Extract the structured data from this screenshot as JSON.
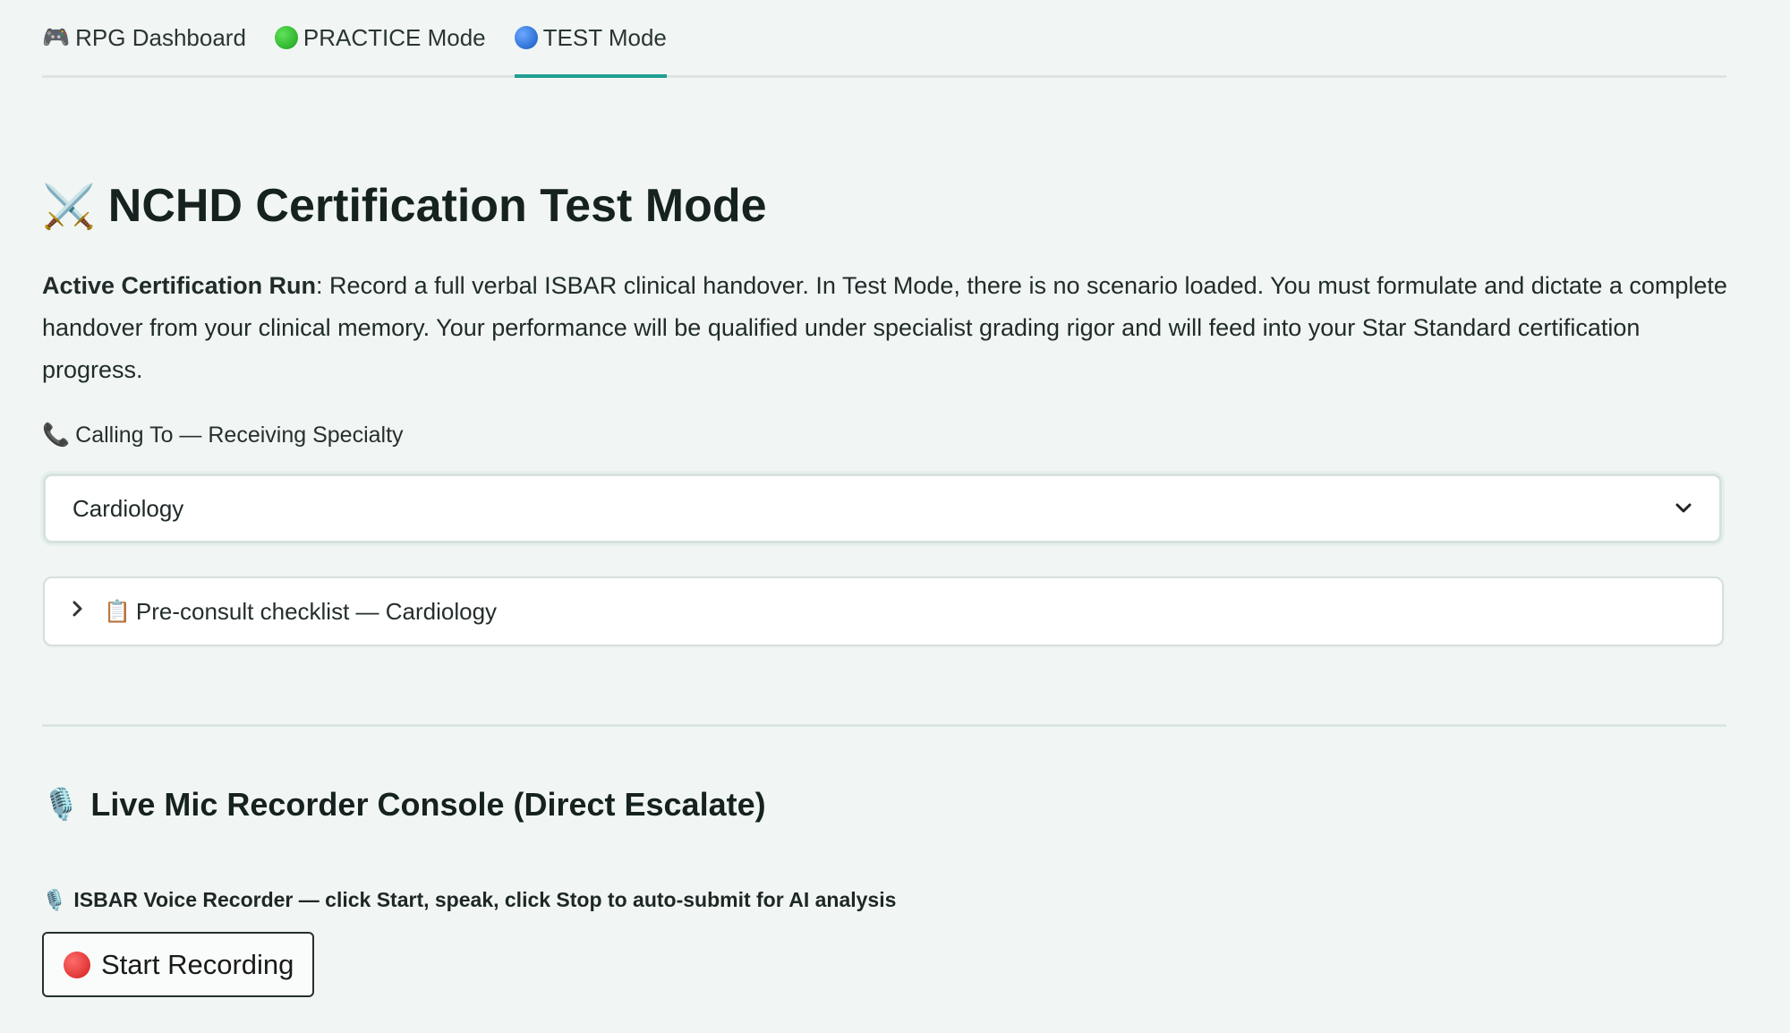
{
  "tabs": [
    {
      "label": "RPG Dashboard",
      "icon": "gamepad-icon",
      "glyph": "🎮"
    },
    {
      "label": "PRACTICE Mode",
      "icon": "green-circle-icon",
      "color": "#27b324"
    },
    {
      "label": "TEST Mode",
      "icon": "blue-circle-icon",
      "color": "#1f6fd6",
      "active": true
    }
  ],
  "title": {
    "icon": "crossed-swords-icon",
    "glyph": "⚔️",
    "text": "NCHD Certification Test Mode"
  },
  "description": {
    "lead": "Active Certification Run",
    "body": ": Record a full verbal ISBAR clinical handover. In Test Mode, there is no scenario loaded. You must formulate and dictate a complete handover from your clinical memory. Your performance will be qualified under specialist grading rigor and will feed into your Star Standard certification progress."
  },
  "specialty": {
    "label_icon": "phone-icon",
    "label_glyph": "📞",
    "label": "Calling To — Receiving Specialty",
    "selected": "Cardiology"
  },
  "checklist": {
    "icon": "clipboard-icon",
    "glyph": "📋",
    "label": "Pre-consult checklist — Cardiology"
  },
  "recorder": {
    "section_icon": "microphone-icon",
    "section_glyph": "🎙️",
    "section_title": "Live Mic Recorder Console (Direct Escalate)",
    "caption_glyph": "🎙️",
    "caption": "ISBAR Voice Recorder — click Start, speak, click Stop to auto-submit for AI analysis",
    "button_label": "Start Recording",
    "button_dot_color": "#d21f1f"
  },
  "colors": {
    "accent": "#1f9e93",
    "background": "#f1f6f4"
  }
}
